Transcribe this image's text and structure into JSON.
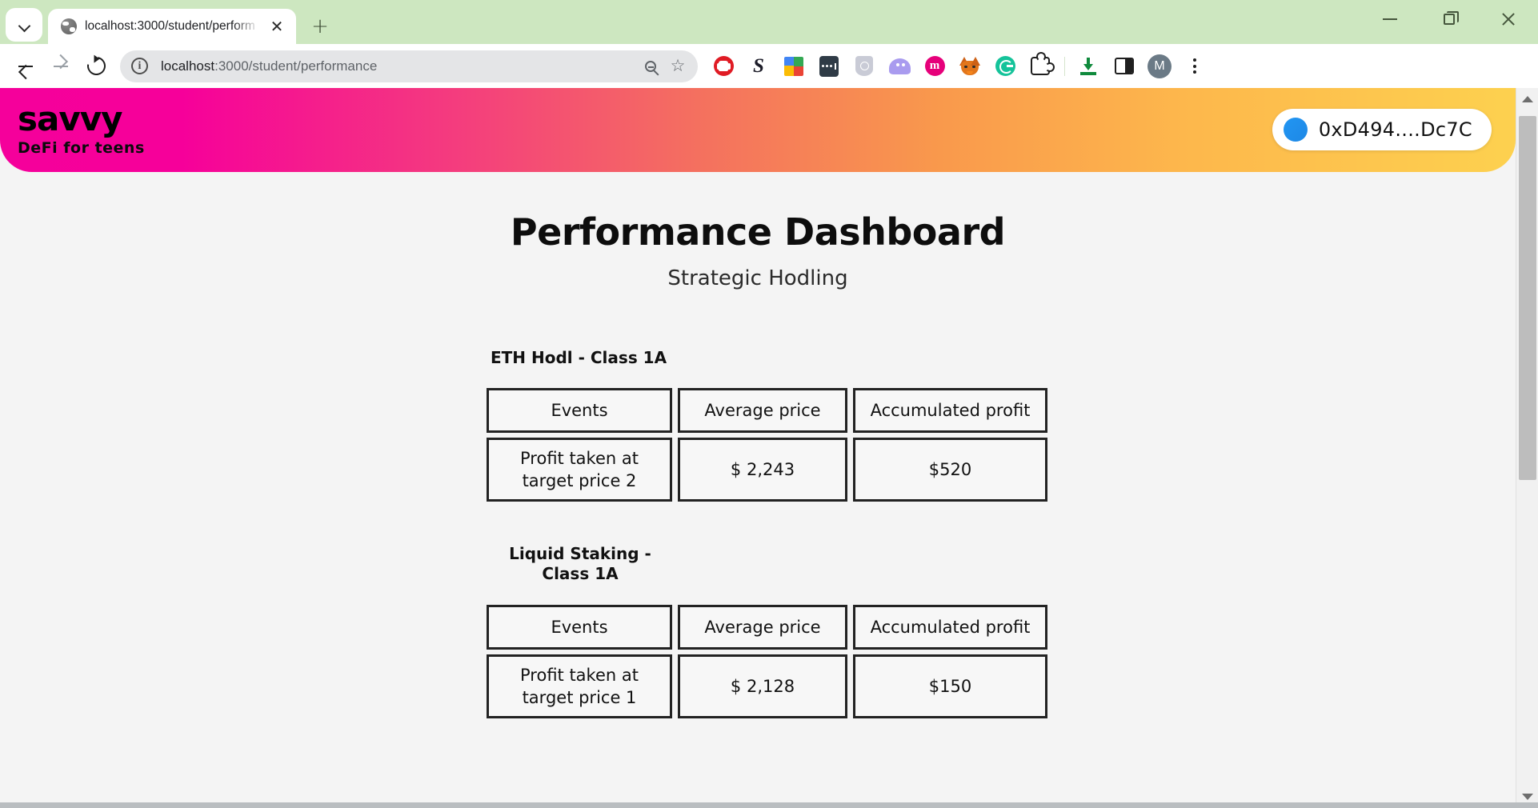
{
  "browser": {
    "tab": {
      "title": "localhost:3000/student/perform",
      "favicon": "globe-icon",
      "close_label": "✕"
    },
    "new_tab_label": "+",
    "tab_search_label": "chevron-down-icon",
    "window_controls": {
      "minimize": "minimize-icon",
      "maximize": "restore-icon",
      "close": "close-icon"
    },
    "toolbar": {
      "back": "back-arrow-icon",
      "forward": "forward-arrow-icon",
      "reload": "reload-icon",
      "url_secure": "localhost",
      "url_rest": ":3000/student/performance",
      "url_full": "localhost:3000/student/performance",
      "zoom_icon": "zoom-out-icon",
      "bookmark_icon": "star-icon",
      "extensions": [
        "adblock-icon",
        "scribe-s-icon",
        "google-icon",
        "password-manager-icon",
        "shield-privacy-icon",
        "ghostery-icon",
        "metamask-m-icon",
        "metamask-fox-icon",
        "grammarly-icon",
        "extensions-puzzle-icon"
      ],
      "downloads_icon": "download-icon",
      "side_panel_icon": "side-panel-icon",
      "profile_initial": "M",
      "menu_icon": "kebab-menu-icon"
    }
  },
  "site": {
    "brand": {
      "name": "savvy",
      "tagline": "DeFi for teens"
    },
    "wallet": {
      "address": "0xD494....Dc7C",
      "avatar": "wallet-avatar-blue-circle"
    },
    "header_gradient": {
      "from": "#F5009B",
      "mid": "#F9994C",
      "to": "#FDD14F"
    }
  },
  "dashboard": {
    "title": "Performance Dashboard",
    "subtitle": "Strategic Hodling",
    "columns": [
      "Events",
      "Average price",
      "Accumulated profit"
    ],
    "sections": [
      {
        "title": "ETH Hodl - Class 1A",
        "title_lines": [
          "ETH Hodl - Class 1A"
        ],
        "rows": [
          {
            "event": "Profit taken at target price 2",
            "average_price": "$ 2,243",
            "accumulated_profit": "$520"
          }
        ]
      },
      {
        "title": "Liquid Staking - Class 1A",
        "title_lines": [
          "Liquid Staking -",
          "Class 1A"
        ],
        "rows": [
          {
            "event": "Profit taken at target price 1",
            "average_price": "$ 2,128",
            "accumulated_profit": "$150"
          }
        ]
      }
    ]
  },
  "scrollbar": {
    "up_arrow": "scroll-up-icon",
    "down_arrow": "scroll-down-icon"
  }
}
